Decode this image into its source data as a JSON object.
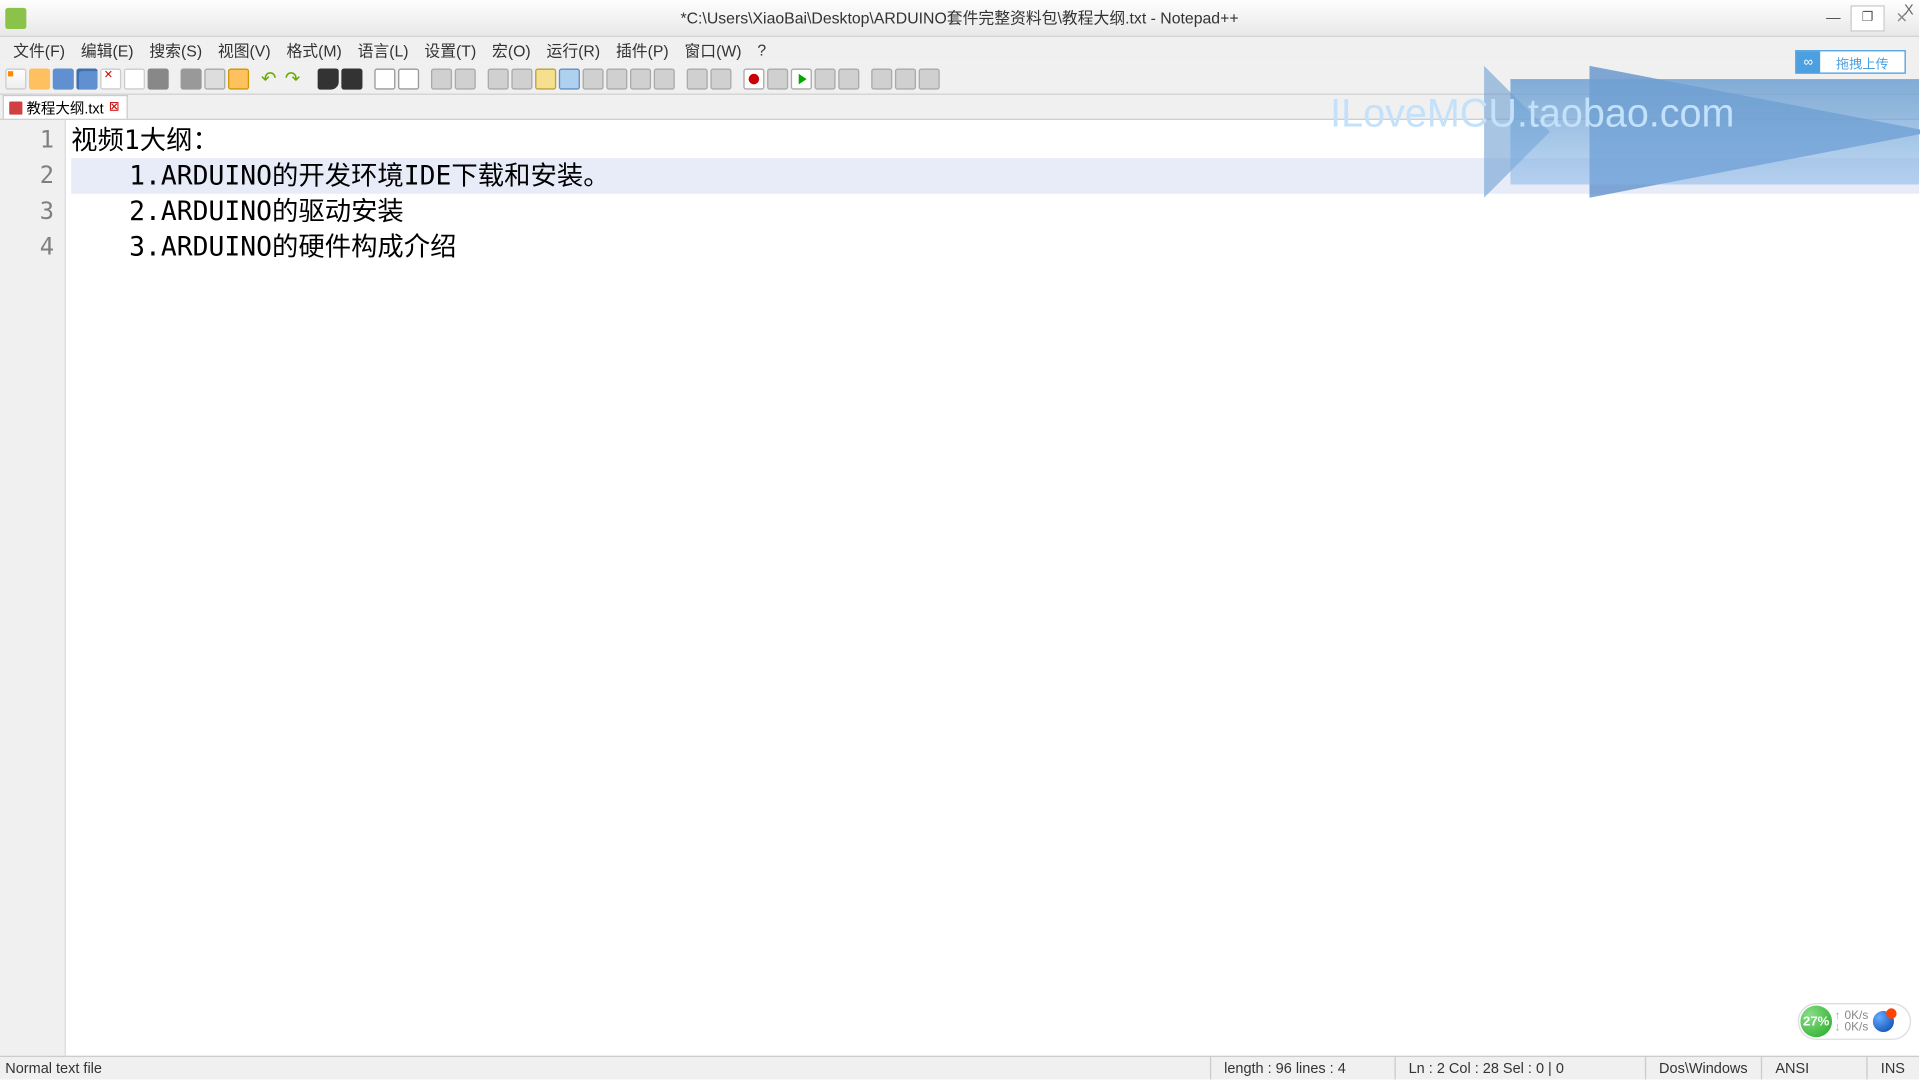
{
  "title": "*C:\\Users\\XiaoBai\\Desktop\\ARDUINO套件完整资料包\\教程大纲.txt - Notepad++",
  "menu": {
    "file": "文件(F)",
    "edit": "编辑(E)",
    "search": "搜索(S)",
    "view": "视图(V)",
    "format": "格式(M)",
    "language": "语言(L)",
    "settings": "设置(T)",
    "macro": "宏(O)",
    "run": "运行(R)",
    "plugins": "插件(P)",
    "window": "窗口(W)",
    "help": "?"
  },
  "cloud_btn": "拖拽上传",
  "tab": {
    "name": "教程大纲.txt",
    "close": "⊠"
  },
  "lines": {
    "l1": "视频1大纲：",
    "l2": "1.ARDUINO的开发环境IDE下载和安装。",
    "l3": "2.ARDUINO的驱动安装",
    "l4": "3.ARDUINO的硬件构成介绍"
  },
  "gutter": {
    "n1": "1",
    "n2": "2",
    "n3": "3",
    "n4": "4"
  },
  "watermark": "ILoveMCU.taobao.com",
  "status": {
    "filetype": "Normal text file",
    "length": "length : 96    lines : 4",
    "pos": "Ln : 2    Col : 28    Sel : 0 | 0",
    "eol": "Dos\\Windows",
    "encoding": "ANSI",
    "mode": "INS"
  },
  "net": {
    "pct": "27%",
    "up": "0K/s",
    "down": "0K/s"
  }
}
